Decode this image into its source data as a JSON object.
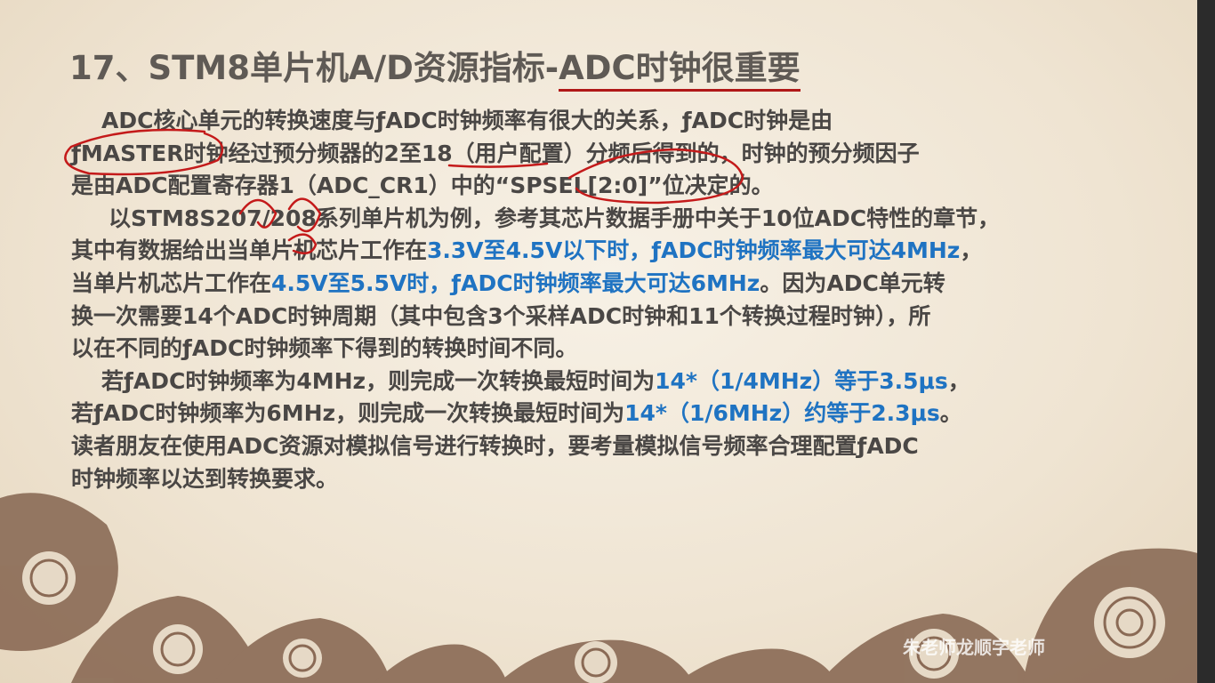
{
  "slide": {
    "title_part1": "17、STM8单片机A/D资源指标-",
    "title_part2": "ADC时钟很重要",
    "lines": [
      [
        "ADC核心单元的转换速度与ƒADC时钟频率有很大的关系，ƒADC时钟是由"
      ],
      [
        "ƒMASTER时钟经过预分频器的2至18（用户配置）分频后得到的，时钟的预分频因子"
      ],
      [
        "是由ADC配置寄存器1（ADC_CR1）中的“SPSEL[2:0]”位决定的。"
      ],
      [
        "以STM8S207/208系列单片机为例，参考其芯片数据手册中关于10位ADC特性的章节，"
      ],
      [
        "其中有数据给出当单片机芯片工作在",
        "3.3V至4.5V以下时，ƒADC时钟频率最大可达4MHz",
        "，"
      ],
      [
        "当单片机芯片工作在",
        "4.5V至5.5V时，ƒADC时钟频率最大可达6MHz",
        "。因为ADC单元转"
      ],
      [
        "换一次需要14个ADC时钟周期（其中包含3个采样ADC时钟和11个转换过程时钟），所"
      ],
      [
        "以在不同的ƒADC时钟频率下得到的转换时间不同。"
      ],
      [
        "若ƒADC时钟频率为4MHz，则完成一次转换最短时间为",
        "14*（1/4MHz）等于3.5μs",
        "，"
      ],
      [
        "若ƒADC时钟频率为6MHz，则完成一次转换最短时间为",
        "14*（1/6MHz）约等于2.3μs",
        "。"
      ],
      [
        "读者朋友在使用ADC资源对模拟信号进行转换时，要考量模拟信号频率合理配置ƒADC"
      ],
      [
        "时钟频率以达到转换要求。"
      ]
    ],
    "watermark": "朱老师龙顺字老师"
  },
  "colors": {
    "title": "#5f5a55",
    "text": "#4a4745",
    "highlight": "#1f73c2",
    "annotation": "#c41a1a",
    "ornament": "#8a6a55"
  }
}
